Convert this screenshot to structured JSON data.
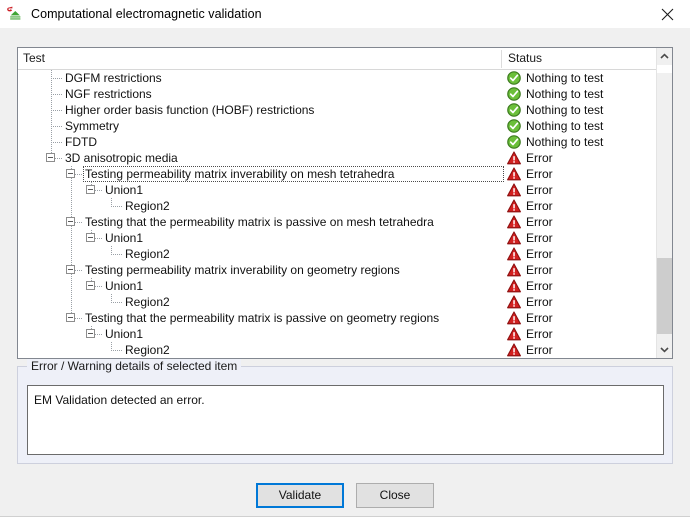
{
  "window": {
    "title": "Computational electromagnetic validation",
    "icon": "app-validation-icon",
    "close_icon": "close-icon"
  },
  "tree": {
    "columns": {
      "test": "Test",
      "status": "Status"
    },
    "scrollbar": {
      "up_icon": "chevron-up-icon",
      "down_icon": "chevron-down-icon"
    },
    "status_labels": {
      "ok": "Nothing to test",
      "error": "Error"
    },
    "status_colors": {
      "ok_fill": "#6bbf3a",
      "ok_border": "#3c7a1e",
      "error_fill": "#d32020",
      "error_border": "#8c1010"
    },
    "rows": [
      {
        "label": "DGFM restrictions",
        "level": 1,
        "expander": "none",
        "status": "Nothing to test",
        "status_type": "ok",
        "focused": false
      },
      {
        "label": "NGF restrictions",
        "level": 1,
        "expander": "none",
        "status": "Nothing to test",
        "status_type": "ok",
        "focused": false
      },
      {
        "label": "Higher order basis function (HOBF) restrictions",
        "level": 1,
        "expander": "none",
        "status": "Nothing to test",
        "status_type": "ok",
        "focused": false
      },
      {
        "label": "Symmetry",
        "level": 1,
        "expander": "none",
        "status": "Nothing to test",
        "status_type": "ok",
        "focused": false
      },
      {
        "label": "FDTD",
        "level": 1,
        "expander": "none",
        "status": "Nothing to test",
        "status_type": "ok",
        "focused": false
      },
      {
        "label": "3D anisotropic media",
        "level": 1,
        "expander": "minus",
        "status": "Error",
        "status_type": "error",
        "focused": false
      },
      {
        "label": "Testing permeability matrix inverability on mesh tetrahedra",
        "level": 2,
        "expander": "minus",
        "status": "Error",
        "status_type": "error",
        "focused": true
      },
      {
        "label": "Union1",
        "level": 3,
        "expander": "minus",
        "status": "Error",
        "status_type": "error",
        "focused": false
      },
      {
        "label": "Region2",
        "level": 4,
        "expander": "none",
        "status": "Error",
        "status_type": "error",
        "focused": false
      },
      {
        "label": "Testing that the permeability matrix is passive on mesh tetrahedra",
        "level": 2,
        "expander": "minus",
        "status": "Error",
        "status_type": "error",
        "focused": false
      },
      {
        "label": "Union1",
        "level": 3,
        "expander": "minus",
        "status": "Error",
        "status_type": "error",
        "focused": false
      },
      {
        "label": "Region2",
        "level": 4,
        "expander": "none",
        "status": "Error",
        "status_type": "error",
        "focused": false
      },
      {
        "label": "Testing permeability matrix inverability on geometry regions",
        "level": 2,
        "expander": "minus",
        "status": "Error",
        "status_type": "error",
        "focused": false
      },
      {
        "label": "Union1",
        "level": 3,
        "expander": "minus",
        "status": "Error",
        "status_type": "error",
        "focused": false
      },
      {
        "label": "Region2",
        "level": 4,
        "expander": "none",
        "status": "Error",
        "status_type": "error",
        "focused": false
      },
      {
        "label": "Testing that the permeability matrix is passive on geometry regions",
        "level": 2,
        "expander": "minus",
        "status": "Error",
        "status_type": "error",
        "focused": false
      },
      {
        "label": "Union1",
        "level": 3,
        "expander": "minus",
        "status": "Error",
        "status_type": "error",
        "focused": false
      },
      {
        "label": "Region2",
        "level": 4,
        "expander": "none",
        "status": "Error",
        "status_type": "error",
        "focused": false
      }
    ]
  },
  "details": {
    "group_title": "Error / Warning details of selected item",
    "message": "EM Validation detected an error."
  },
  "buttons": {
    "validate": "Validate",
    "close": "Close",
    "focus_color": "#0078d7"
  }
}
